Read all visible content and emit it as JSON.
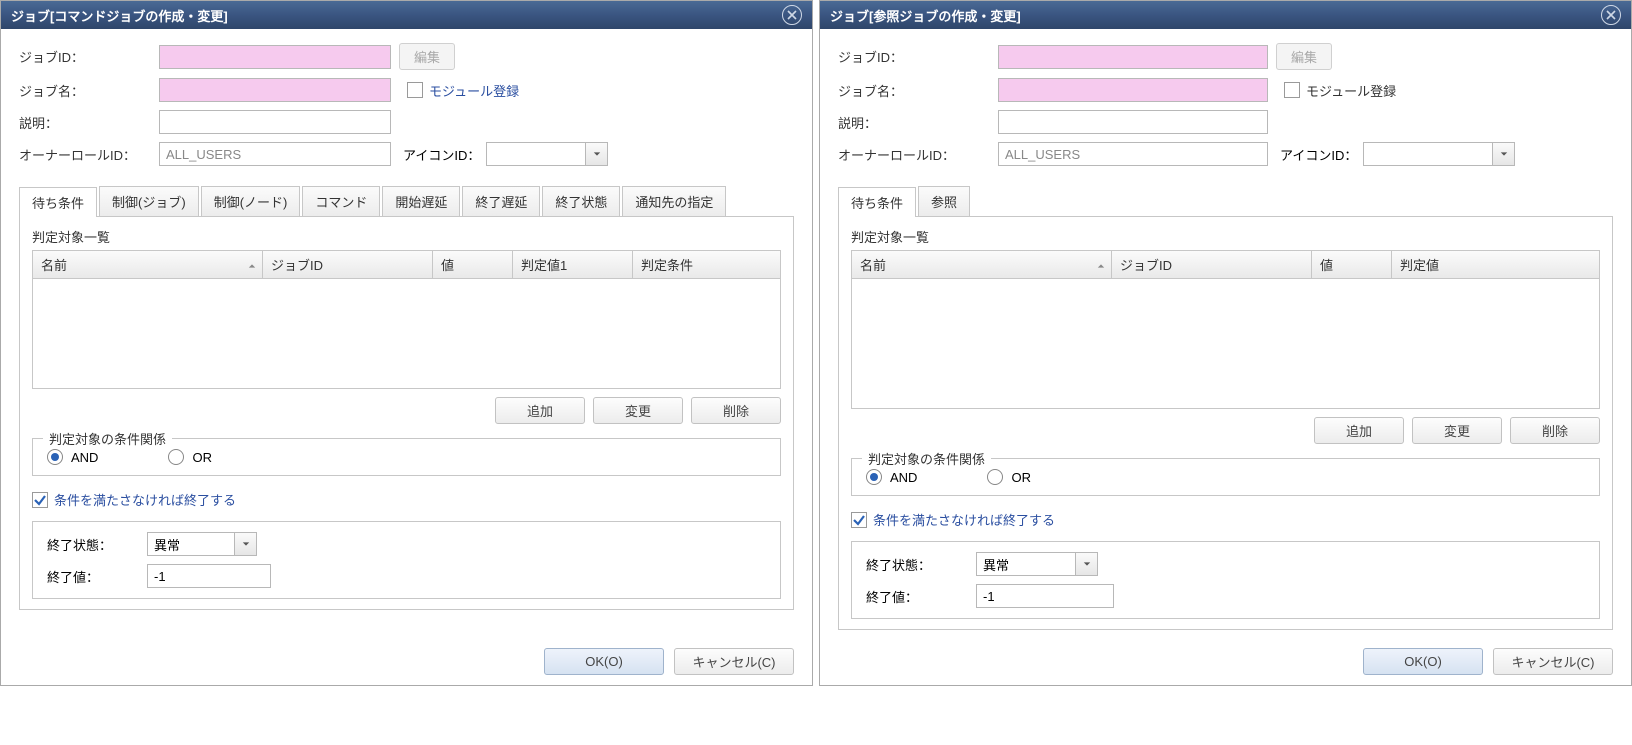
{
  "left": {
    "title": "ジョブ[コマンドジョブの作成・変更]",
    "labels": {
      "job_id": "ジョブID：",
      "job_name": "ジョブ名：",
      "desc": "説明：",
      "owner_role": "オーナーロールID：",
      "icon_id": "アイコンID：",
      "edit": "編集",
      "module_reg": "モジュール登録"
    },
    "values": {
      "job_id": "",
      "job_name": "",
      "desc": "",
      "owner_role": "ALL_USERS",
      "icon_id": ""
    },
    "tabs": [
      "待ち条件",
      "制御(ジョブ)",
      "制御(ノード)",
      "コマンド",
      "開始遅延",
      "終了遅延",
      "終了状態",
      "通知先の指定"
    ],
    "table": {
      "title": "判定対象一覧",
      "cols": [
        "名前",
        "ジョブID",
        "値",
        "判定値1",
        "判定条件"
      ]
    },
    "buttons": {
      "add": "追加",
      "change": "変更",
      "delete": "削除"
    },
    "group": {
      "legend": "判定対象の条件関係",
      "and": "AND",
      "or": "OR"
    },
    "end_chk": "条件を満たさなければ終了する",
    "end": {
      "state_label": "終了状態：",
      "state_value": "異常",
      "val_label": "終了値：",
      "val_value": "-1"
    },
    "footer": {
      "ok": "OK(O)",
      "cancel": "キャンセル(C)"
    }
  },
  "right": {
    "title": "ジョブ[参照ジョブの作成・変更]",
    "labels": {
      "job_id": "ジョブID：",
      "job_name": "ジョブ名：",
      "desc": "説明：",
      "owner_role": "オーナーロールID：",
      "icon_id": "アイコンID：",
      "edit": "編集",
      "module_reg": "モジュール登録"
    },
    "values": {
      "job_id": "",
      "job_name": "",
      "desc": "",
      "owner_role": "ALL_USERS",
      "icon_id": ""
    },
    "tabs": [
      "待ち条件",
      "参照"
    ],
    "table": {
      "title": "判定対象一覧",
      "cols": [
        "名前",
        "ジョブID",
        "値",
        "判定値"
      ]
    },
    "buttons": {
      "add": "追加",
      "change": "変更",
      "delete": "削除"
    },
    "group": {
      "legend": "判定対象の条件関係",
      "and": "AND",
      "or": "OR"
    },
    "end_chk": "条件を満たさなければ終了する",
    "end": {
      "state_label": "終了状態：",
      "state_value": "異常",
      "val_label": "終了値：",
      "val_value": "-1"
    },
    "footer": {
      "ok": "OK(O)",
      "cancel": "キャンセル(C)"
    }
  }
}
